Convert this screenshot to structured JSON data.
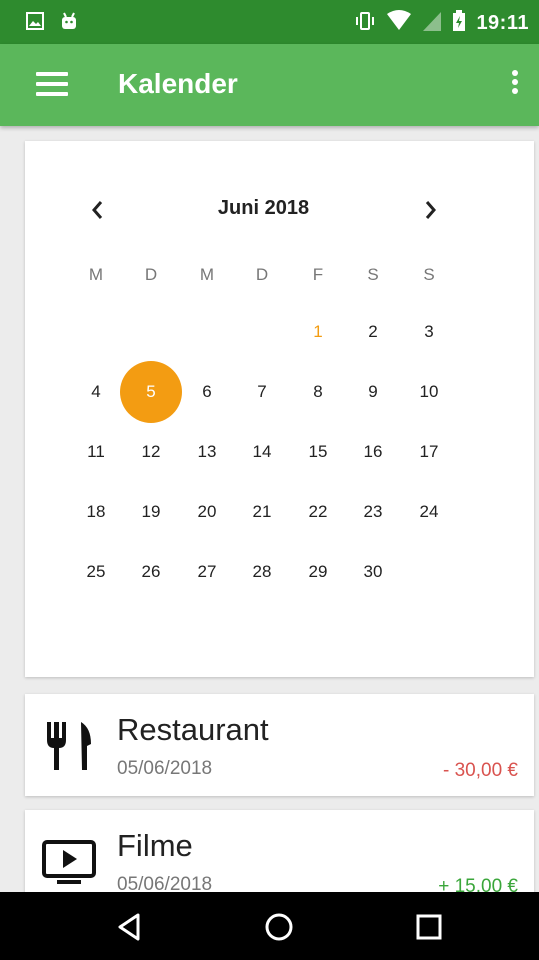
{
  "status_bar": {
    "time": "19:11",
    "left_icons": [
      "image-icon",
      "android-icon"
    ],
    "right_icons": [
      "vibrate-icon",
      "wifi-icon",
      "signal-icon",
      "battery-icon"
    ]
  },
  "app_bar": {
    "title": "Kalender",
    "menu_icon": "hamburger-menu-icon",
    "overflow_icon": "more-vertical-icon"
  },
  "calendar": {
    "month_label": "Juni 2018",
    "weekdays": [
      "M",
      "D",
      "M",
      "D",
      "F",
      "S",
      "S"
    ],
    "weeks": [
      [
        "",
        "",
        "",
        "",
        "1",
        "2",
        "3"
      ],
      [
        "4",
        "5",
        "6",
        "7",
        "8",
        "9",
        "10"
      ],
      [
        "11",
        "12",
        "13",
        "14",
        "15",
        "16",
        "17"
      ],
      [
        "18",
        "19",
        "20",
        "21",
        "22",
        "23",
        "24"
      ],
      [
        "25",
        "26",
        "27",
        "28",
        "29",
        "30",
        ""
      ]
    ],
    "today": "1",
    "selected": "5",
    "accent_color": "#f39c12"
  },
  "transactions": [
    {
      "title": "Restaurant",
      "date": "05/06/2018",
      "amount": "- 30,00 €",
      "icon": "restaurant-icon",
      "amount_color": "#d9534f"
    },
    {
      "title": "Filme",
      "date": "05/06/2018",
      "amount": "+ 15,00 €",
      "icon": "movie-icon",
      "amount_color": "#3aa63a"
    }
  ],
  "nav_bar": {
    "buttons": [
      "back-icon",
      "home-icon",
      "recents-icon"
    ]
  },
  "colors": {
    "status_bar": "#2e8b2e",
    "app_bar": "#5bb75b"
  }
}
